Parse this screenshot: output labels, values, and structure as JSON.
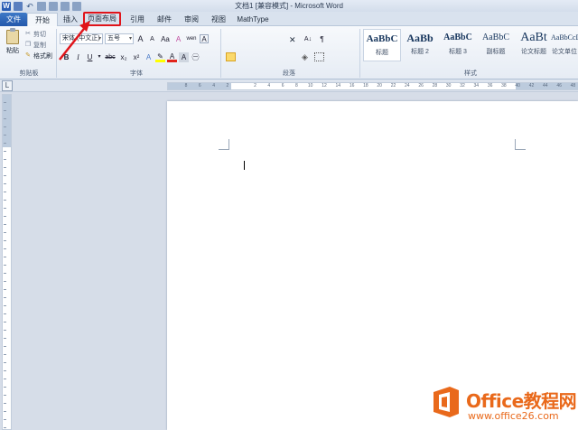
{
  "window": {
    "title": "文档1 [兼容模式] - Microsoft Word"
  },
  "quick_access": {
    "word_icon": "W",
    "undo_icon": "↶"
  },
  "tabs": {
    "file": "文件",
    "home": "开始",
    "insert": "插入",
    "layout": "页面布局",
    "references": "引用",
    "mailings": "邮件",
    "review": "审阅",
    "view": "视图",
    "mathtype": "MathType"
  },
  "clipboard": {
    "paste": "粘贴",
    "cut": "剪切",
    "copy": "复制",
    "format_painter": "格式刷",
    "group": "剪贴板"
  },
  "font": {
    "name": "宋体 (中文正)",
    "size": "五号",
    "group": "字体",
    "grow": "A",
    "shrink": "A",
    "case": "Aa",
    "clear": "A",
    "phonetic": "wen",
    "border": "A",
    "bold": "B",
    "italic": "I",
    "underline": "U",
    "strike": "abc",
    "sub": "x₂",
    "sup": "x²",
    "highlight_color": "#ffff00",
    "font_color": "#e2241b"
  },
  "paragraph": {
    "group": "段落",
    "sort": "A↓",
    "show_marks": "¶"
  },
  "styles": {
    "group": "样式",
    "items": [
      {
        "sample": "AaBbC",
        "name": "标题"
      },
      {
        "sample": "AaBb",
        "name": "标题 2"
      },
      {
        "sample": "AaBbC",
        "name": "标题 3"
      },
      {
        "sample": "AaBbC",
        "name": "副标题"
      },
      {
        "sample": "AaBt",
        "name": "论文标题"
      },
      {
        "sample": "AaBbCcD",
        "name": "论文单位"
      }
    ]
  },
  "ruler": {
    "corner": "L",
    "ticks": [
      "8",
      "6",
      "4",
      "2",
      "",
      "2",
      "4",
      "6",
      "8",
      "10",
      "12",
      "14",
      "16",
      "18",
      "20",
      "22",
      "24",
      "26",
      "28",
      "30",
      "32",
      "34",
      "36",
      "38",
      "40",
      "42",
      "44",
      "46",
      "48"
    ]
  },
  "watermark": {
    "brand": "Office教程网",
    "url": "www.office26.com"
  },
  "colors": {
    "accent": "#2a5db5",
    "highlight_red": "#e0141a",
    "brand_orange": "#e9691b"
  }
}
